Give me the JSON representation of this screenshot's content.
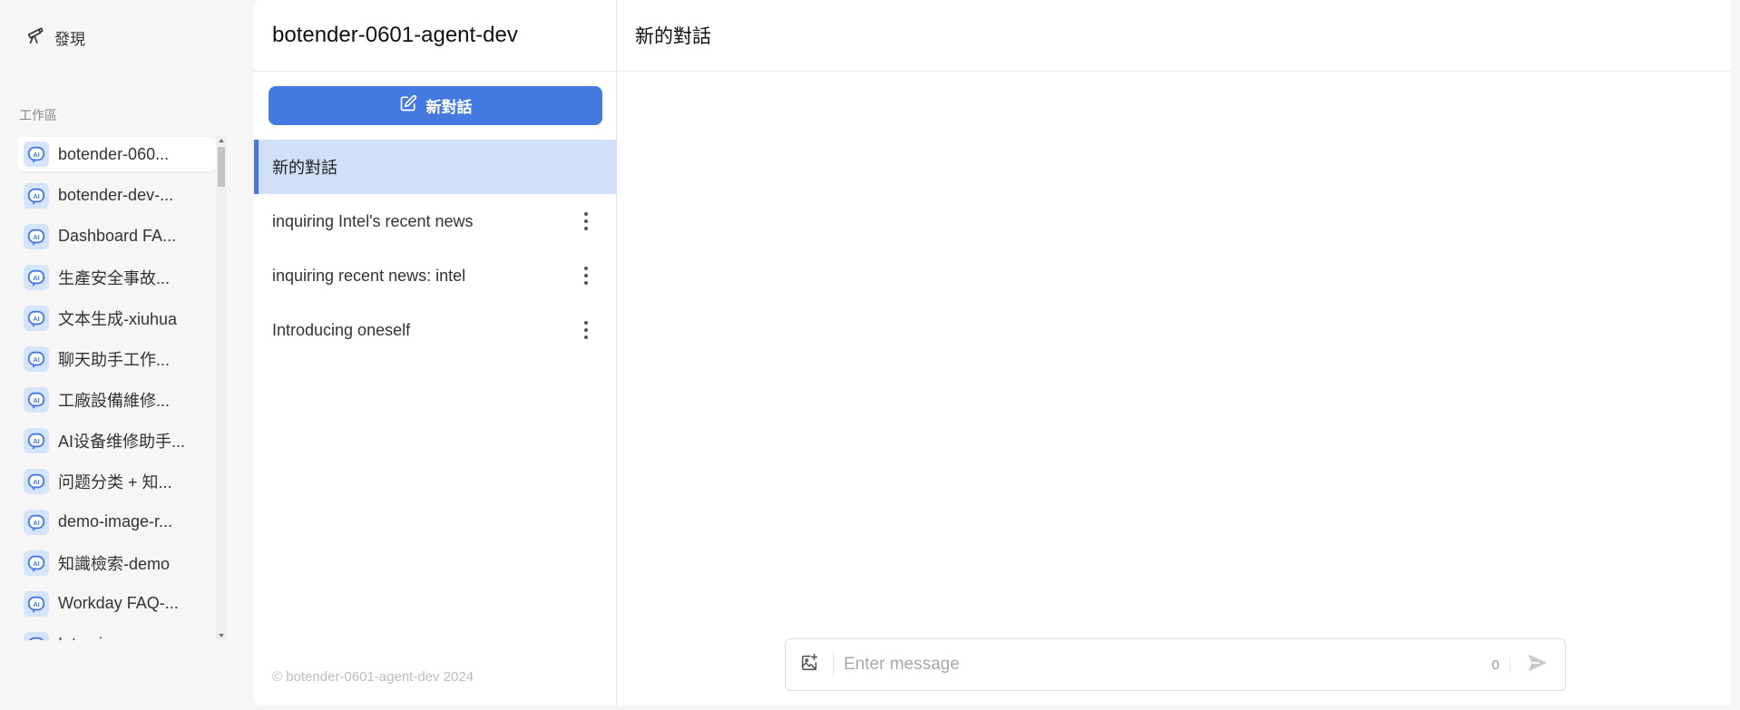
{
  "sidebar": {
    "discover_label": "發現",
    "workspace_label": "工作區",
    "apps": [
      {
        "name": "botender-060..."
      },
      {
        "name": "botender-dev-..."
      },
      {
        "name": "Dashboard FA..."
      },
      {
        "name": "生產安全事故..."
      },
      {
        "name": "文本生成-xiuhua"
      },
      {
        "name": "聊天助手工作..."
      },
      {
        "name": "工廠設備維修..."
      },
      {
        "name": "AI设备维修助手..."
      },
      {
        "name": "问题分类 + 知..."
      },
      {
        "name": "demo-image-r..."
      },
      {
        "name": "知識檢索-demo"
      },
      {
        "name": "Workday FAQ-..."
      },
      {
        "name": "Intervi..."
      }
    ],
    "app_icon": "ai-bot-icon"
  },
  "conversations": {
    "app_title": "botender-0601-agent-dev",
    "new_chat_label": "新對話",
    "items": [
      {
        "title": "新的對話",
        "active": true
      },
      {
        "title": "inquiring Intel's recent news",
        "active": false
      },
      {
        "title": "inquiring recent news: intel",
        "active": false
      },
      {
        "title": "Introducing oneself",
        "active": false
      }
    ],
    "footer": "© botender-0601-agent-dev 2024"
  },
  "chat": {
    "title": "新的對話",
    "input": {
      "placeholder": "Enter message",
      "value": "",
      "char_count": "0"
    }
  },
  "colors": {
    "accent": "#4479e1",
    "active_row": "#d1dff8",
    "app_icon_bg": "#d4e4fb"
  }
}
